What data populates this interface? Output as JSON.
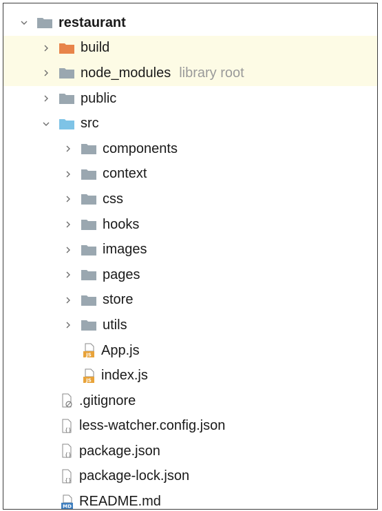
{
  "tree": {
    "root": {
      "label": "restaurant"
    },
    "build": {
      "label": "build"
    },
    "node_modules": {
      "label": "node_modules",
      "hint": "library root"
    },
    "public": {
      "label": "public"
    },
    "src": {
      "label": "src"
    },
    "src_children": [
      {
        "label": "components"
      },
      {
        "label": "context"
      },
      {
        "label": "css"
      },
      {
        "label": "hooks"
      },
      {
        "label": "images"
      },
      {
        "label": "pages"
      },
      {
        "label": "store"
      },
      {
        "label": "utils"
      }
    ],
    "src_files": [
      {
        "label": "App.js",
        "badge": "JS"
      },
      {
        "label": "index.js",
        "badge": "JS"
      }
    ],
    "root_files": [
      {
        "label": ".gitignore",
        "icon": "ignore-file-icon"
      },
      {
        "label": "less-watcher.config.json",
        "icon": "json-file-icon"
      },
      {
        "label": "package.json",
        "icon": "json-file-icon"
      },
      {
        "label": "package-lock.json",
        "icon": "json-file-icon"
      },
      {
        "label": "README.md",
        "icon": "markdown-file-icon",
        "badge": "MD"
      }
    ]
  },
  "colors": {
    "folder": "#9aa7b0",
    "folder_excluded": "#e8844a",
    "folder_source": "#7ec3e6",
    "excluded_bg": "#fdfbe5",
    "js_badge": "#e8a33a",
    "md_badge": "#3f7fbf"
  }
}
